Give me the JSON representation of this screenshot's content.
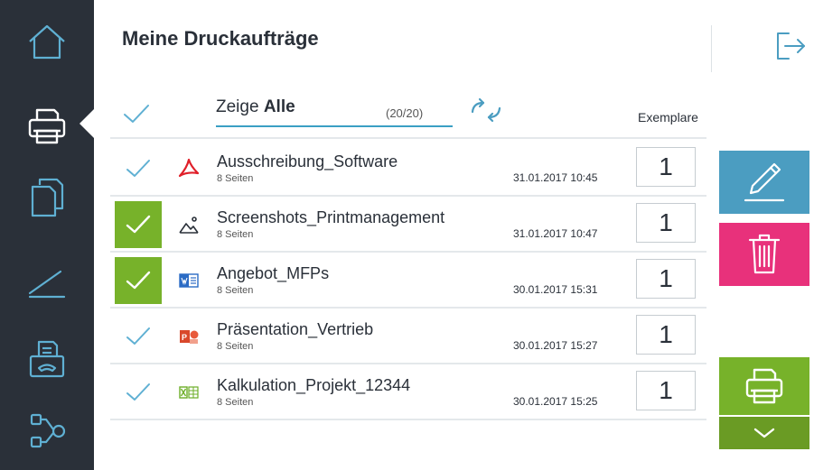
{
  "header": {
    "title": "Meine Druckaufträge"
  },
  "sidebar": {
    "items": [
      {
        "icon": "home-icon"
      },
      {
        "icon": "printer-icon",
        "active": true
      },
      {
        "icon": "copy-icon"
      },
      {
        "icon": "scan-icon"
      },
      {
        "icon": "fax-icon"
      },
      {
        "icon": "workflow-icon"
      }
    ]
  },
  "filter": {
    "prefix": "Zeige",
    "value": "Alle",
    "count": "(20/20)"
  },
  "columns": {
    "copies_label": "Exemplare"
  },
  "jobs": [
    {
      "name": "Ausschreibung_Software",
      "pages": "8 Seiten",
      "date": "31.01.2017  10:45",
      "copies": "1",
      "selected": false,
      "filetype": "pdf-icon"
    },
    {
      "name": "Screenshots_Printmanagement",
      "pages": "8 Seiten",
      "date": "31.01.2017  10:47",
      "copies": "1",
      "selected": true,
      "filetype": "image-icon"
    },
    {
      "name": "Angebot_MFPs",
      "pages": "8 Seiten",
      "date": "30.01.2017  15:31",
      "copies": "1",
      "selected": true,
      "filetype": "word-icon"
    },
    {
      "name": "Präsentation_Vertrieb",
      "pages": "8 Seiten",
      "date": "30.01.2017  15:27",
      "copies": "1",
      "selected": false,
      "filetype": "powerpoint-icon"
    },
    {
      "name": "Kalkulation_Projekt_12344",
      "pages": "8 Seiten",
      "date": "30.01.2017  15:25",
      "copies": "1",
      "selected": false,
      "filetype": "excel-icon"
    }
  ],
  "colors": {
    "sidebar": "#2a3039",
    "accent_blue": "#4b9dc1",
    "selected_green": "#77b22a",
    "delete_pink": "#e8317b"
  }
}
